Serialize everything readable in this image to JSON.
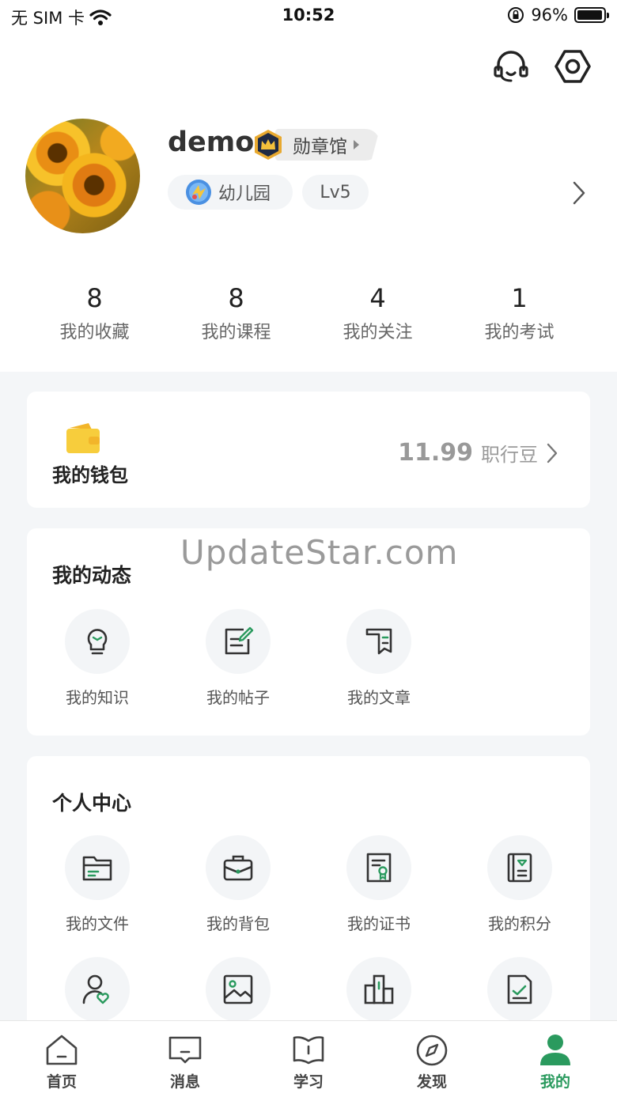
{
  "status_bar": {
    "carrier": "无 SIM 卡",
    "time": "10:52",
    "battery": "96%",
    "battery_level": 0.96
  },
  "profile": {
    "username": "demo",
    "medal_label": "勋章馆",
    "level_name": "幼儿园",
    "level": "Lv5"
  },
  "stats": [
    {
      "value": "8",
      "label": "我的收藏"
    },
    {
      "value": "8",
      "label": "我的课程"
    },
    {
      "value": "4",
      "label": "我的关注"
    },
    {
      "value": "1",
      "label": "我的考试"
    }
  ],
  "wallet": {
    "label": "我的钱包",
    "amount": "11.99",
    "unit": "职行豆"
  },
  "activity": {
    "title": "我的动态",
    "items": [
      {
        "label": "我的知识",
        "icon": "lightbulb-icon"
      },
      {
        "label": "我的帖子",
        "icon": "post-edit-icon"
      },
      {
        "label": "我的文章",
        "icon": "article-icon"
      }
    ]
  },
  "personal": {
    "title": "个人中心",
    "items": [
      {
        "label": "我的文件",
        "icon": "folder-icon"
      },
      {
        "label": "我的背包",
        "icon": "backpack-icon"
      },
      {
        "label": "我的证书",
        "icon": "certificate-icon"
      },
      {
        "label": "我的积分",
        "icon": "points-book-icon"
      },
      {
        "label": "",
        "icon": "user-heart-icon"
      },
      {
        "label": "",
        "icon": "image-icon"
      },
      {
        "label": "",
        "icon": "building-icon"
      },
      {
        "label": "",
        "icon": "document-check-icon"
      }
    ]
  },
  "watermark": "UpdateStar.com",
  "tabs": [
    {
      "label": "首页",
      "icon": "home-icon"
    },
    {
      "label": "消息",
      "icon": "message-icon"
    },
    {
      "label": "学习",
      "icon": "book-icon"
    },
    {
      "label": "发现",
      "icon": "compass-icon"
    },
    {
      "label": "我的",
      "icon": "profile-icon",
      "active": true
    }
  ],
  "colors": {
    "accent": "#2a9a5e",
    "background": "#f4f6f8",
    "wallet_yellow": "#f5c631"
  }
}
